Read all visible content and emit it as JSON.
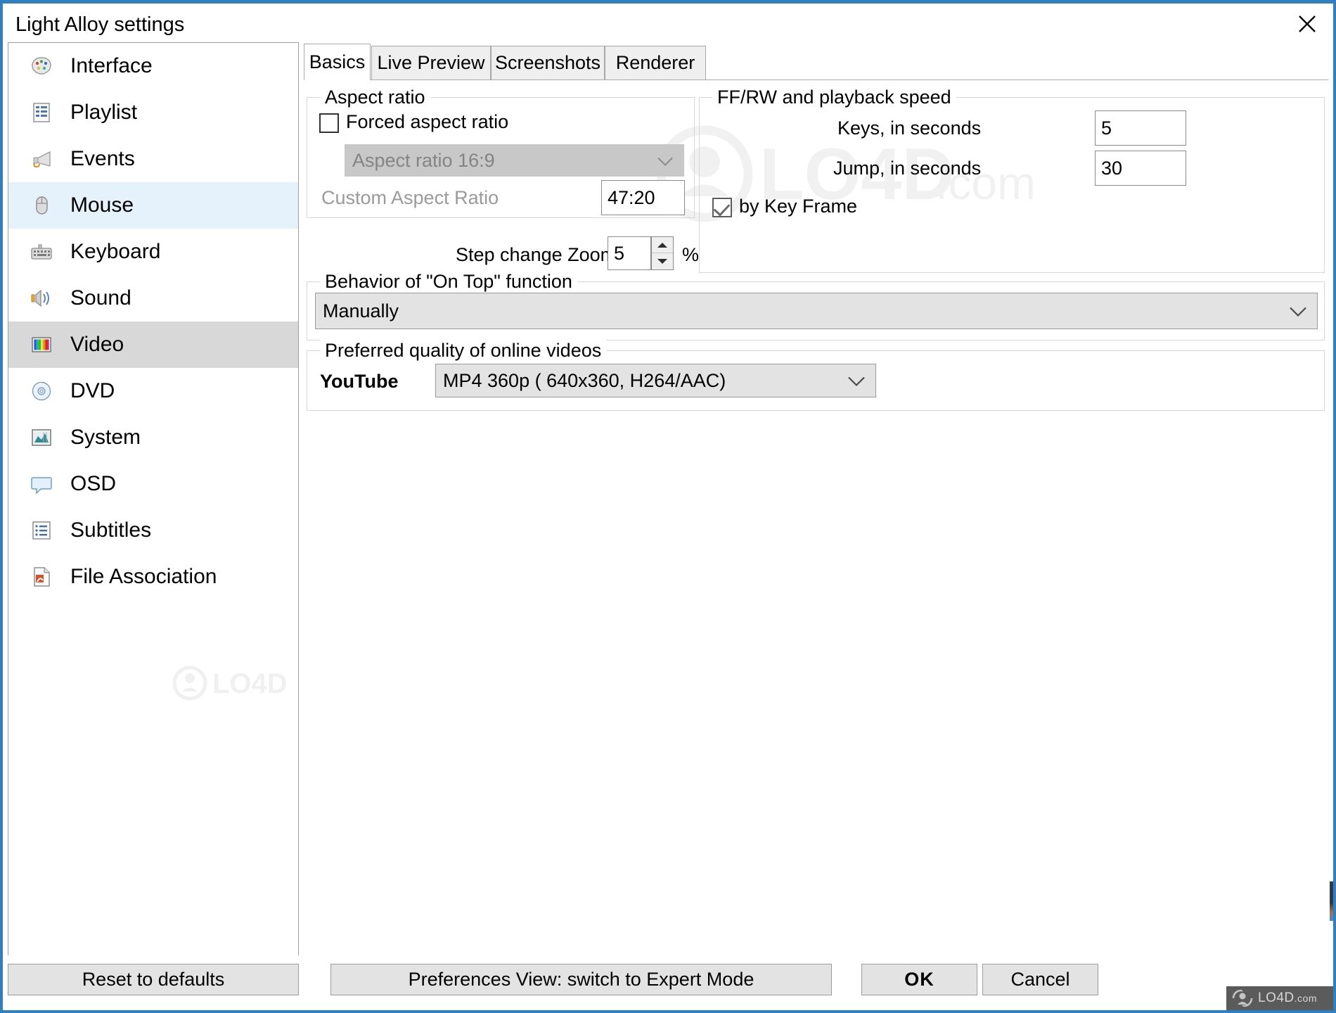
{
  "window": {
    "title": "Light Alloy settings",
    "close_icon": "close-icon",
    "accent_color": "#2f7fc1"
  },
  "sidebar": {
    "items": [
      {
        "label": "Interface",
        "icon": "palette-icon",
        "state": "normal"
      },
      {
        "label": "Playlist",
        "icon": "list-page-icon",
        "state": "normal"
      },
      {
        "label": "Events",
        "icon": "megaphone-icon",
        "state": "normal"
      },
      {
        "label": "Mouse",
        "icon": "mouse-icon",
        "state": "hover"
      },
      {
        "label": "Keyboard",
        "icon": "keyboard-icon",
        "state": "normal"
      },
      {
        "label": "Sound",
        "icon": "speaker-icon",
        "state": "normal"
      },
      {
        "label": "Video",
        "icon": "color-bars-icon",
        "state": "selected"
      },
      {
        "label": "DVD",
        "icon": "disc-icon",
        "state": "normal"
      },
      {
        "label": "System",
        "icon": "chart-frame-icon",
        "state": "normal"
      },
      {
        "label": "OSD",
        "icon": "speech-bubble-icon",
        "state": "normal"
      },
      {
        "label": "Subtitles",
        "icon": "bullet-list-icon",
        "state": "normal"
      },
      {
        "label": "File Association",
        "icon": "file-link-icon",
        "state": "normal"
      }
    ],
    "watermark": "LO4D.com"
  },
  "tabs": [
    {
      "label": "Basics",
      "active": true
    },
    {
      "label": "Live Preview",
      "active": false
    },
    {
      "label": "Screenshots",
      "active": false
    },
    {
      "label": "Renderer",
      "active": false
    }
  ],
  "aspect_ratio": {
    "group_title": "Aspect ratio",
    "forced_checkbox_label": "Forced aspect ratio",
    "forced_checked": false,
    "preset_value": "Aspect ratio 16:9",
    "preset_disabled": true,
    "custom_label": "Custom Aspect Ratio",
    "custom_value": "47:20"
  },
  "ffrw": {
    "group_title": "FF/RW and playback speed",
    "keys_label": "Keys, in seconds",
    "keys_value": "5",
    "jump_label": "Jump, in seconds",
    "jump_value": "30",
    "keyframe_label": "by Key Frame",
    "keyframe_checked": true
  },
  "step_zoom": {
    "label": "Step change Zoom",
    "value": "5",
    "unit": "%",
    "up_icon": "spin-up-icon",
    "down_icon": "spin-down-icon"
  },
  "on_top": {
    "group_title": "Behavior of \"On Top\" function",
    "value": "Manually",
    "chevron_icon": "chevron-down-icon"
  },
  "online_quality": {
    "group_title": "Preferred quality of online videos",
    "service_label": "YouTube",
    "value": "MP4    360p  ( 640x360,  H264/AAC)",
    "chevron_icon": "chevron-down-icon"
  },
  "footer": {
    "reset_label": "Reset to defaults",
    "preferences_label": "Preferences View: switch to Expert Mode",
    "ok_label": "OK",
    "cancel_label": "Cancel"
  },
  "watermarks": {
    "center": "LO4D.com",
    "badge_main": "LO4D",
    "badge_suffix": ".com"
  }
}
